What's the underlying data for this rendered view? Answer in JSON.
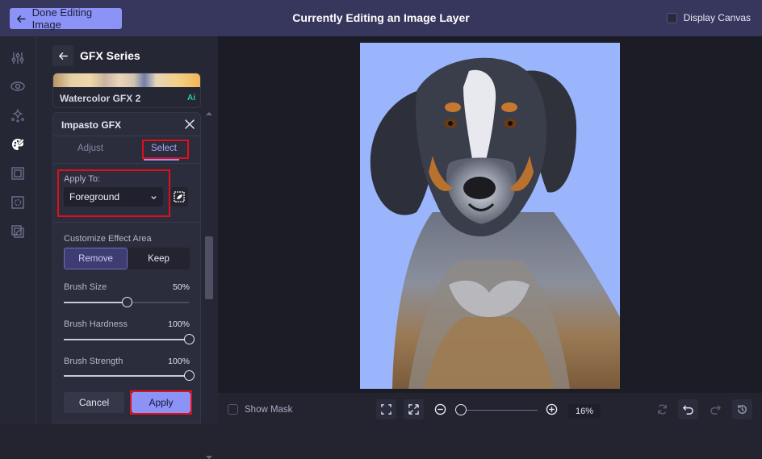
{
  "topbar": {
    "done_label": "Done Editing Image",
    "title": "Currently Editing an Image Layer",
    "display_canvas_label": "Display Canvas",
    "display_canvas_checked": false
  },
  "rail": {
    "icons": [
      "sliders-icon",
      "eye-icon",
      "sparkles-icon",
      "palette-icon",
      "frame-icon",
      "texture-icon",
      "overlay-icon"
    ],
    "active": "palette-icon"
  },
  "panel": {
    "title": "GFX Series",
    "prev_effect": {
      "label": "Watercolor GFX 2",
      "badge": "Ai"
    },
    "editor": {
      "title": "Impasto GFX",
      "tabs": [
        {
          "label": "Adjust",
          "active": false
        },
        {
          "label": "Select",
          "active": true
        }
      ],
      "apply_to": {
        "label": "Apply To:",
        "value": "Foreground"
      },
      "customize": {
        "label": "Customize Effect Area",
        "options": [
          {
            "label": "Remove",
            "active": true
          },
          {
            "label": "Keep",
            "active": false
          }
        ]
      },
      "sliders": [
        {
          "label": "Brush Size",
          "value_text": "50%",
          "value": 0.5
        },
        {
          "label": "Brush Hardness",
          "value_text": "100%",
          "value": 1.0
        },
        {
          "label": "Brush Strength",
          "value_text": "100%",
          "value": 1.0
        }
      ],
      "cancel_label": "Cancel",
      "apply_label": "Apply"
    }
  },
  "canvas": {
    "background_color": "#9ab5fb",
    "image_description": "Painted impasto portrait of a bluetick coonhound dog"
  },
  "bottombar": {
    "show_mask_label": "Show Mask",
    "show_mask_checked": false,
    "zoom_value": "16%",
    "zoom_fraction": 0.0
  },
  "colors": {
    "accent": "#8c93f7",
    "topbar": "#37365d",
    "highlight_box": "#e0101a",
    "ai_badge": "#2fc9a4"
  }
}
